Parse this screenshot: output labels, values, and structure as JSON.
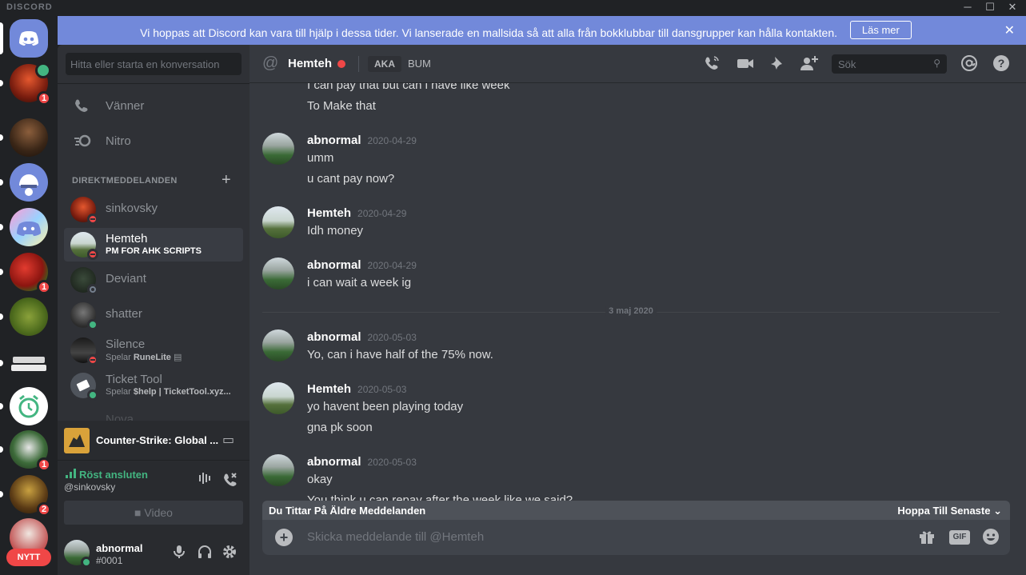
{
  "app": {
    "brand": "DISCORD",
    "window_controls": {
      "minimize": "─",
      "maximize": "☐",
      "close": "✕"
    }
  },
  "banner": {
    "message": "Vi hoppas att Discord kan vara till hjälp i dessa tider. Vi lanserade en mallsida så att alla från bokklubbar till dansgrupper kan hålla kontakten.",
    "button": "Läs mer",
    "close": "✕",
    "color": "#7289da"
  },
  "guilds": {
    "badges": {
      "sinkovsky": "1",
      "red_pepper": "1",
      "unicorn": "1",
      "alex": "2"
    },
    "new_label": "NYTT"
  },
  "sidebar": {
    "search_placeholder": "Hitta eller starta en konversation",
    "nav": [
      {
        "label": "Vänner",
        "icon": "friends-icon"
      },
      {
        "label": "Nitro",
        "icon": "nitro-icon"
      }
    ],
    "dm_header": "DIREKTMEDDELANDEN",
    "dms": [
      {
        "name": "sinkovsky",
        "sub": "",
        "status": "dnd"
      },
      {
        "name": "Hemteh",
        "sub": "PM FOR AHK SCRIPTS",
        "status": "dnd"
      },
      {
        "name": "Deviant",
        "sub": "",
        "status": "idle"
      },
      {
        "name": "shatter",
        "sub": "",
        "status": "online"
      },
      {
        "name": "Silence",
        "sub_prefix": "Spelar",
        "sub": "RuneLite",
        "status": "dnd"
      },
      {
        "name": "Ticket Tool",
        "sub_prefix": "Spelar",
        "sub": "$help | TicketTool.xyz...",
        "status": "online"
      },
      {
        "name": "Nova",
        "sub": "",
        "status": "online"
      }
    ]
  },
  "activity": {
    "game": "Counter-Strike: Global ..."
  },
  "voice": {
    "connected": "Röst ansluten",
    "channel": "@sinkovsky",
    "video": "Video"
  },
  "user": {
    "name": "abnormal",
    "tag": "#0001"
  },
  "chat": {
    "header": {
      "name": "Hemteh",
      "aka_label": "AKA",
      "aka_value": "BUM",
      "search_placeholder": "Sök"
    },
    "partial_top": "I can pay that but can i have like week",
    "messages": [
      {
        "author": "",
        "time": "",
        "lines": [
          "To Make that"
        ]
      },
      {
        "author": "abnormal",
        "time": "2020-04-29",
        "lines": [
          "umm",
          "u cant pay now?"
        ]
      },
      {
        "author": "Hemteh",
        "time": "2020-04-29",
        "lines": [
          "Idh money"
        ]
      },
      {
        "author": "abnormal",
        "time": "2020-04-29",
        "lines": [
          "i can wait a week ig"
        ]
      },
      {
        "author": "abnormal",
        "time": "2020-05-03",
        "lines": [
          "Yo, can i have half of the 75% now."
        ]
      },
      {
        "author": "Hemteh",
        "time": "2020-05-03",
        "lines": [
          "yo havent been playing today",
          "gna pk soon"
        ]
      },
      {
        "author": "abnormal",
        "time": "2020-05-03",
        "lines": [
          "okay",
          "You think u can repay after the week like we said?"
        ]
      }
    ],
    "date_divider": "3 maj 2020",
    "older_notice": "Du Tittar På Äldre Meddelanden",
    "jump_latest": "Hoppa Till Senaste",
    "composer_placeholder": "Skicka meddelande till @Hemteh",
    "gif_label": "GIF"
  }
}
